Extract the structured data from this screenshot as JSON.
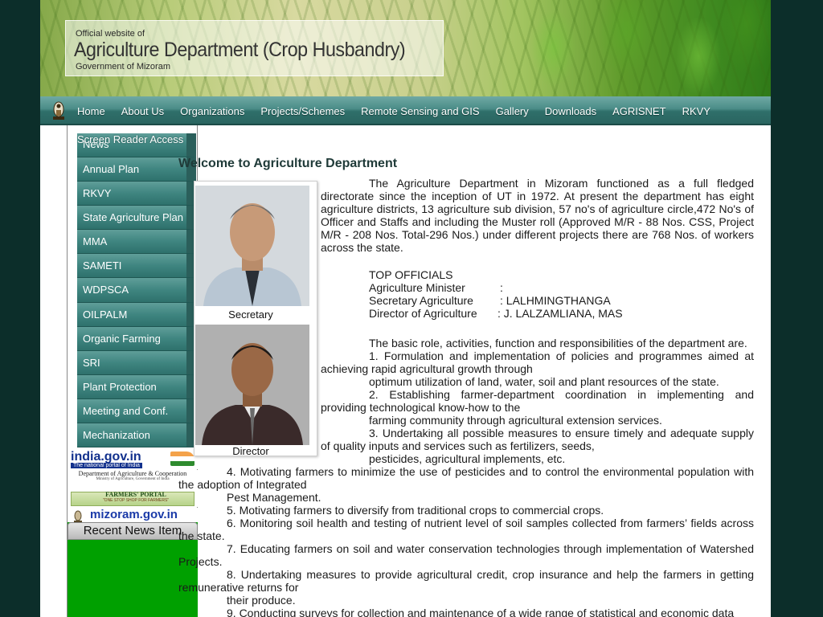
{
  "banner": {
    "line1": "Official website of",
    "line2": "Agriculture Department (Crop Husbandry)",
    "line3": "Government of Mizoram"
  },
  "nav": {
    "items": [
      "Home",
      "About Us",
      "Organizations",
      "Projects/Schemes",
      "Remote Sensing and GIS",
      "Gallery",
      "Downloads",
      "AGRISNET",
      "RKVY"
    ]
  },
  "screen_reader": "Screen Reader Access",
  "sidebar": {
    "items": [
      "News",
      "Annual Plan",
      "RKVY",
      "State Agriculture Plan",
      "MMA",
      "SAMETI",
      "WDPSCA",
      "OILPALM",
      "Organic Farming",
      "SRI",
      "Plant Protection",
      "Meeting and Conf.",
      "Mechanization"
    ],
    "logos": {
      "india_title": "india.gov.in",
      "india_sub": "The national portal of India",
      "doac_title": "Department of Agriculture & Cooperation",
      "doac_sub": "Ministry of Agriculture, Government of India",
      "farmers_title": "FARMERS' PORTAL",
      "farmers_sub": "\"ONE STOP SHOP FOR FARMERS\"",
      "mizoram": "mizoram.gov.in"
    },
    "recent_news": "Recent News Item"
  },
  "photos": {
    "secretary": "Secretary",
    "director": "Director"
  },
  "content": {
    "title": "Welcome to Agriculture Department",
    "intro": "The Agriculture Department in Mizoram functioned as a full fledged directorate since the inception of UT in 1972. At present the department has eight agriculture districts, 13 agriculture sub division, 57 no's of agriculture circle,472 No's of Officer and Staffs and including the Muster roll (Approved M/R - 88 Nos. CSS, Project M/R - 208 Nos. Total-296 Nos.) under different projects there are 768 Nos. of workers across the state.",
    "officials_heading": "TOP OFFICIALS",
    "officials": [
      {
        "role": "Agriculture Minister",
        "sep": ":",
        "name": ""
      },
      {
        "role": "Secretary Agriculture",
        "sep": ": LALHMINGTHANGA",
        "name": ""
      },
      {
        "role": "Director of Agriculture",
        "sep": ": J. LALZAMLIANA, MAS",
        "name": ""
      }
    ],
    "roles_intro": "The basic role, activities, function and responsibilities of the department are.",
    "r1a": "1. Formulation and implementation of policies and programmes aimed at achieving rapid agricultural growth through",
    "r1b": "optimum utilization of land, water, soil and plant resources of the state.",
    "r2a": "2. Establishing farmer-department coordination in implementing and providing technological know-how to the",
    "r2b": "farming community through agricultural extension services.",
    "r3a": "3. Undertaking all possible measures to ensure timely and adequate supply of quality inputs and services such as fertilizers, seeds,",
    "r3b": "pesticides, agricultural implements, etc.",
    "r4a": "4. Motivating farmers to minimize the use of pesticides and to control the environmental population with the adoption of Integrated",
    "r4b": "Pest Management.",
    "r5": "5. Motivating farmers to diversify from traditional crops to commercial crops.",
    "r6": "6. Monitoring soil health and testing of nutrient level of soil samples collected from farmers’ fields across the state.",
    "r7": "7. Educating farmers on soil and water conservation technologies through implementation of Watershed Projects.",
    "r8a": "8. Undertaking measures to provide agricultural credit, crop insurance and help the farmers in getting remunerative returns for",
    "r8b": "their produce.",
    "r9": "9. Conducting surveys for collection and maintenance of a wide range of statistical and economic data"
  }
}
